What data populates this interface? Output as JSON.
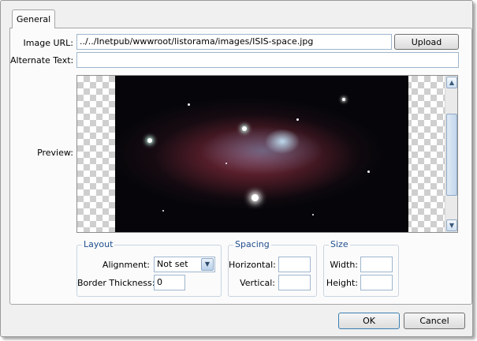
{
  "tabs": [
    {
      "label": "General"
    }
  ],
  "image_url": {
    "label": "Image URL:",
    "value": "../../Inetpub/wwwroot/listorama/images/ISIS-space.jpg"
  },
  "upload_label": "Upload",
  "alternate_text": {
    "label": "Alternate Text:",
    "value": ""
  },
  "preview": {
    "label": "Preview:"
  },
  "layout": {
    "legend": "Layout",
    "alignment": {
      "label": "Alignment:",
      "selected": "Not set"
    },
    "border_thickness": {
      "label": "Border Thickness:",
      "value": "0"
    }
  },
  "spacing": {
    "legend": "Spacing",
    "horizontal": {
      "label": "Horizontal:",
      "value": ""
    },
    "vertical": {
      "label": "Vertical:",
      "value": ""
    }
  },
  "size": {
    "legend": "Size",
    "width": {
      "label": "Width:",
      "value": ""
    },
    "height": {
      "label": "Height:",
      "value": ""
    }
  },
  "footer": {
    "ok_label": "OK",
    "cancel_label": "Cancel"
  },
  "colors": {
    "legend_text": "#1f4e8c",
    "field_border": "#9fb6cd"
  }
}
